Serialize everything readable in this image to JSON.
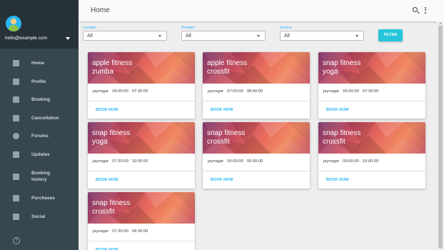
{
  "sidebar": {
    "email": "hello@example.com",
    "items": [
      {
        "label": "Home",
        "icon": "home-icon"
      },
      {
        "label": "Profile",
        "icon": "inbox-icon"
      },
      {
        "label": "Booking",
        "icon": "bookmark-icon"
      },
      {
        "label": "Cancellation",
        "icon": "trash-icon"
      },
      {
        "label": "Forums",
        "icon": "info-icon"
      },
      {
        "label": "Updates",
        "icon": "forum-icon"
      },
      {
        "label": "Booking history",
        "icon": "flag-icon"
      },
      {
        "label": "Purchases",
        "icon": "tag-icon"
      },
      {
        "label": "Social",
        "icon": "cart-icon"
      }
    ],
    "help_icon": "help-icon"
  },
  "header": {
    "title": "Home"
  },
  "filters": [
    {
      "label": "Location",
      "value": "All"
    },
    {
      "label": "Provider",
      "value": "All"
    },
    {
      "label": "Service",
      "value": "All"
    }
  ],
  "filter_button": "FILTER",
  "cards": [
    {
      "provider": "apple fitness",
      "service": "zumba",
      "location": "jaynagar",
      "start": "06:00:00",
      "end": "07:30:00",
      "action": "BOOK NOW"
    },
    {
      "provider": "apple fitness",
      "service": "crossfit",
      "location": "jaynagar",
      "start": "07:00:00",
      "end": "08:00:00",
      "action": "BOOK NOW"
    },
    {
      "provider": "snap fitness",
      "service": "yoga",
      "location": "jaynagar",
      "start": "06:00:00",
      "end": "07:30:00",
      "action": "BOOK NOW"
    },
    {
      "provider": "snap fitness",
      "service": "yoga",
      "location": "jaynagar",
      "start": "07:30:00",
      "end": "10:00:00",
      "action": "BOOK NOW"
    },
    {
      "provider": "snap fitness",
      "service": "crossfit",
      "location": "jaynagar",
      "start": "00:00:00",
      "end": "00:00:00",
      "action": "BOOK NOW"
    },
    {
      "provider": "snap fitness",
      "service": "crossfit",
      "location": "jaynagar",
      "start": "09:00:00",
      "end": "10:00:00",
      "action": "BOOK NOW"
    },
    {
      "provider": "snap fitness",
      "service": "crossfit",
      "location": "jaynagar",
      "start": "07:30:00",
      "end": "09:30:00",
      "action": "BOOK NOW"
    }
  ],
  "colors": {
    "accent": "#29b6f6",
    "filter_button": "#26c6da",
    "sidebar": "#37474f",
    "sidebar_header": "#263238"
  }
}
